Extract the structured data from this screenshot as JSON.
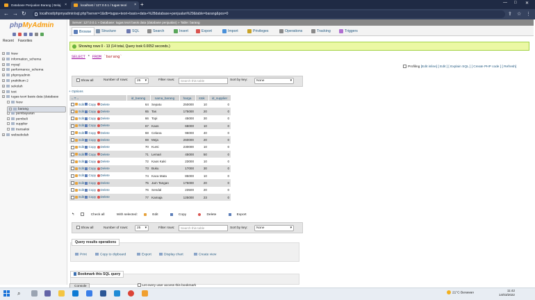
{
  "browser": {
    "tabs": [
      {
        "title": "Database Penjualan Barang | Belaj",
        "active": false
      },
      {
        "title": "localhost / 127.0.0.1 / tugas teori",
        "active": true
      }
    ],
    "new_tab": "+",
    "url": "localhost/phpmyadmin/sql.php?server=1&db=tugas+teori+basis+data+%28database+penjualan%29&table=barang&pos=0"
  },
  "sidebar": {
    "logo_php": "php",
    "logo_my": "MyAdmin",
    "recent": "Recent",
    "favorites": "Favorites",
    "databases": [
      {
        "label": "New",
        "level": 0,
        "selected": false
      },
      {
        "label": "information_schema",
        "level": 0,
        "selected": false
      },
      {
        "label": "mysql",
        "level": 0,
        "selected": false
      },
      {
        "label": "performance_schema",
        "level": 0,
        "selected": false
      },
      {
        "label": "phpmyadmin",
        "level": 0,
        "selected": false
      },
      {
        "label": "praktikum 2",
        "level": 0,
        "selected": false
      },
      {
        "label": "sekolah",
        "level": 0,
        "selected": false
      },
      {
        "label": "test",
        "level": 0,
        "selected": false
      },
      {
        "label": "tugas teori basis data (database",
        "level": 0,
        "selected": false
      },
      {
        "label": "New",
        "level": 1,
        "selected": false
      },
      {
        "label": "barang",
        "level": 1,
        "selected": true
      },
      {
        "label": "pembayaran",
        "level": 1,
        "selected": false
      },
      {
        "label": "pembeli",
        "level": 1,
        "selected": false
      },
      {
        "label": "supplier",
        "level": 1,
        "selected": false
      },
      {
        "label": "transaksi",
        "level": 1,
        "selected": false
      },
      {
        "label": "websekolah",
        "level": 0,
        "selected": false
      }
    ]
  },
  "breadcrumb": "Server: 127.0.0.1 » Database: tugas teori basis data (database penjualan) » Table: barang",
  "top_tabs": [
    {
      "label": "Browse",
      "icon": "browse-icon",
      "color": "#5b7db8",
      "active": true
    },
    {
      "label": "Structure",
      "icon": "structure-icon",
      "color": "#7a8fa8",
      "active": false
    },
    {
      "label": "SQL",
      "icon": "sql-icon",
      "color": "#6c78af",
      "active": false
    },
    {
      "label": "Search",
      "icon": "search-icon",
      "color": "#8a8a8a",
      "active": false
    },
    {
      "label": "Insert",
      "icon": "insert-icon",
      "color": "#5aa65a",
      "active": false
    },
    {
      "label": "Export",
      "icon": "export-icon",
      "color": "#d9534f",
      "active": false
    },
    {
      "label": "Import",
      "icon": "import-icon",
      "color": "#4a90d9",
      "active": false
    },
    {
      "label": "Privileges",
      "icon": "privileges-icon",
      "color": "#c9a227",
      "active": false
    },
    {
      "label": "Operations",
      "icon": "operations-icon",
      "color": "#8a8a8a",
      "active": false
    },
    {
      "label": "Tracking",
      "icon": "tracking-icon",
      "color": "#8a8a8a",
      "active": false
    },
    {
      "label": "Triggers",
      "icon": "triggers-icon",
      "color": "#b06fd1",
      "active": false
    }
  ],
  "success_message": "Showing rows 0 - 13 (14 total, Query took 0.0052 seconds.)",
  "query": {
    "select": "SELECT",
    "star": "*",
    "from": "FROM",
    "table": "`barang`"
  },
  "profiling": {
    "label": "Profiling",
    "links": "[Edit inline] [ Edit ] [ Explain SQL ] [ Create PHP code ] [ Refresh]"
  },
  "nav": {
    "show_all": "Show all",
    "number_of_rows_label": "Number of rows:",
    "number_of_rows": "25",
    "filter_label": "Filter rows:",
    "filter_placeholder": "Search this table",
    "sort_label": "Sort by key:",
    "sort_value": "None"
  },
  "options_link": "+ Options",
  "table": {
    "header_arrows": "←T→",
    "columns": [
      "id_barang",
      "nama_barang",
      "harga",
      "stok",
      "id_supplier"
    ],
    "actions": {
      "edit": "Edit",
      "copy": "Copy",
      "delete": "Delete"
    },
    "rows": [
      [
        "64",
        "Sepatu",
        "250000",
        "10",
        "0"
      ],
      [
        "65",
        "Tas",
        "175000",
        "20",
        "0"
      ],
      [
        "66",
        "Topi",
        "45000",
        "30",
        "0"
      ],
      [
        "67",
        "Kaos",
        "68000",
        "10",
        "0"
      ],
      [
        "68",
        "Celana",
        "96000",
        "40",
        "0"
      ],
      [
        "69",
        "Meja",
        "260000",
        "20",
        "0"
      ],
      [
        "70",
        "Kursi",
        "230000",
        "10",
        "0"
      ],
      [
        "71",
        "Lemari",
        "45000",
        "50",
        "0"
      ],
      [
        "72",
        "Kaos Kaki",
        "23000",
        "10",
        "0"
      ],
      [
        "73",
        "Buku",
        "17000",
        "30",
        "0"
      ],
      [
        "74",
        "Kaca Mata",
        "85000",
        "10",
        "0"
      ],
      [
        "75",
        "Jam Tangan",
        "175000",
        "20",
        "0"
      ],
      [
        "76",
        "Sendal",
        "23500",
        "20",
        "0"
      ],
      [
        "77",
        "Kamaja",
        "125000",
        "23",
        "0"
      ]
    ]
  },
  "bulk": {
    "check_all": "Check all",
    "with_selected": "With selected:",
    "edit": "Edit",
    "copy": "Copy",
    "delete": "Delete",
    "export": "Export"
  },
  "query_results": {
    "title": "Query results operations",
    "print": "Print",
    "copy": "Copy to clipboard",
    "export": "Export",
    "chart": "Display chart",
    "view": "Create view"
  },
  "bookmark_title": "Bookmark this SQL query",
  "console": "Console",
  "let_every": "Let every user access this bookmark",
  "taskbar": {
    "search_icon": "search-icon",
    "weather": "21°C  Berawan",
    "time": "11:42",
    "date": "14/03/2022"
  }
}
